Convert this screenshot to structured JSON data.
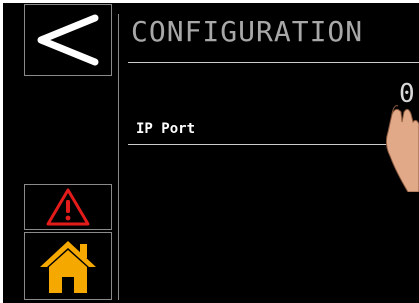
{
  "header": {
    "title": "CONFIGURATION"
  },
  "settings": {
    "rows": [
      {
        "label": "IP Port",
        "value": "0"
      }
    ]
  },
  "nav": {
    "back_icon": "chevron-left-icon",
    "warning_icon": "warning-triangle-icon",
    "home_icon": "home-icon"
  },
  "colors": {
    "background": "#000000",
    "warning": "#e31b1b",
    "home": "#f5a800",
    "text": "#ffffff",
    "title": "#a8a8a8"
  }
}
